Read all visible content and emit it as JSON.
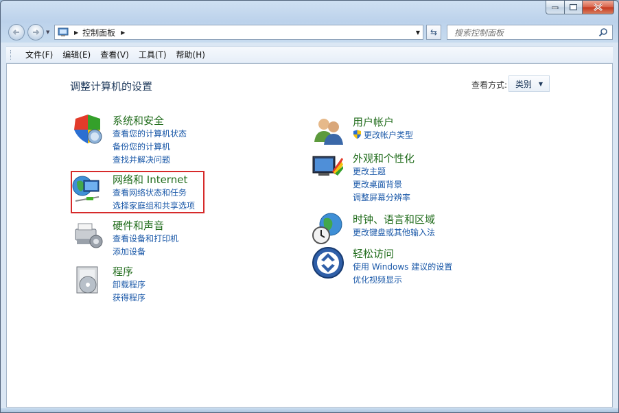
{
  "address": {
    "root_label": "控制面板",
    "search_placeholder": "搜索控制面板"
  },
  "menu": {
    "items": [
      "文件(F)",
      "编辑(E)",
      "查看(V)",
      "工具(T)",
      "帮助(H)"
    ]
  },
  "page": {
    "title": "调整计算机的设置",
    "view_by_label": "查看方式:",
    "view_by_value": "类别"
  },
  "categories_left": [
    {
      "title": "系统和安全",
      "links": [
        "查看您的计算机状态",
        "备份您的计算机",
        "查找并解决问题"
      ],
      "icon": "system-security-icon"
    },
    {
      "title": "网络和 Internet",
      "links": [
        "查看网络状态和任务",
        "选择家庭组和共享选项"
      ],
      "icon": "network-internet-icon"
    },
    {
      "title": "硬件和声音",
      "links": [
        "查看设备和打印机",
        "添加设备"
      ],
      "icon": "hardware-sound-icon"
    },
    {
      "title": "程序",
      "links": [
        "卸载程序",
        "获得程序"
      ],
      "icon": "programs-icon"
    }
  ],
  "categories_right": [
    {
      "title": "用户帐户",
      "links": [
        "更改帐户类型"
      ],
      "icon": "user-accounts-icon"
    },
    {
      "title": "外观和个性化",
      "links": [
        "更改主题",
        "更改桌面背景",
        "调整屏幕分辨率"
      ],
      "icon": "appearance-icon"
    },
    {
      "title": "时钟、语言和区域",
      "links": [
        "更改键盘或其他输入法"
      ],
      "icon": "clock-language-icon"
    },
    {
      "title": "轻松访问",
      "links": [
        "使用 Windows 建议的设置",
        "优化视频显示"
      ],
      "icon": "ease-of-access-icon"
    }
  ],
  "colors": {
    "category_title": "#1f6b1a",
    "link": "#1a58a8",
    "highlight_box": "#d62a2a"
  }
}
